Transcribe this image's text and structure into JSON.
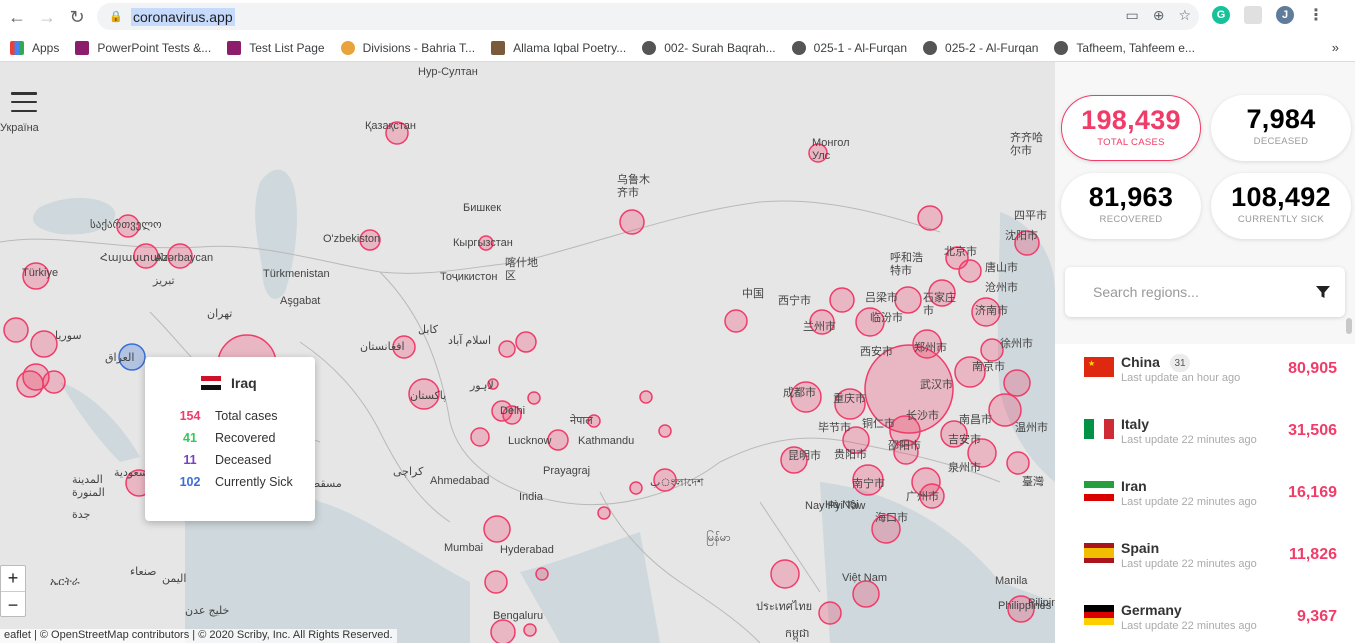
{
  "browser": {
    "url": "coronavirus.app",
    "bookmarks": [
      "Apps",
      "PowerPoint Tests &...",
      "Test List Page",
      "Divisions - Bahria T...",
      "Allama Iqbal Poetry...",
      "002- Surah Baqrah...",
      "025-1 - Al-Furqan",
      "025-2 - Al-Furqan",
      "Tafheem, Tahfeem e..."
    ],
    "bookmark_colors": [
      "#e94235",
      "#8b1d6b",
      "#8b1d6b",
      "#e8a33a",
      "#7a5a3a",
      "#555555",
      "#555555",
      "#555555",
      "#555555"
    ],
    "more": "»",
    "ext_g": "G",
    "profile": "J"
  },
  "map": {
    "labels": [
      "Нур-Султан",
      "Україна",
      "Қазақстан",
      "Монгол\nУлс",
      "乌鲁木\n齐市",
      "Бишкек",
      "საქართველო",
      "Հայաստան",
      "Azərbaycan",
      "O'zbekiston",
      "Кыргызстан",
      "Türkiye",
      "Türkmenistan",
      "Aşgabat",
      "Тоҷикистон",
      "喀什地\n区",
      "تبریز",
      "سوريا",
      "العراق",
      "تهران",
      "کابل",
      "اسلام آباد",
      "افغانستان",
      "پاکستان",
      "لاہور",
      "Delhi",
      "नेपाल",
      "Lucknow",
      "Kathmandu",
      "Prayagraj",
      "Ahmedabad",
      "India",
      "كراچى",
      "Mumbai",
      "Hyderabad",
      "Bengaluru",
      "بংলাদেশ",
      "မြန်မာ",
      "Nay Pyi Taw",
      "Việt Nam",
      "Hà Nội",
      "ประเทศไทย",
      "中国",
      "西宁市",
      "兰州市",
      "呼和浩\n特市",
      "北京市",
      "唐山市",
      "沈阳市",
      "四平市",
      "齐齐哈\n尔市",
      "吕梁市",
      "石家庄\n市",
      "沧州市",
      "济南市",
      "临汾市",
      "西安市",
      "郑州市",
      "徐州市",
      "南京市",
      "武汉市",
      "成都市",
      "重庆市",
      "铜仁市",
      "长沙市",
      "南昌市",
      "温州市",
      "毕节市",
      "贵阳市",
      "邵阳市",
      "吉安市",
      "泉州市",
      "昆明市",
      "南宁市",
      "广州市",
      "海口市",
      "臺灣",
      "Manila",
      "Philippines",
      "المدينة\nالمنورة",
      "جدة",
      "صنعاء",
      "اليمن",
      "ኤርትራ",
      "مسقط",
      "السعودية",
      "خليج عدن",
      "កម្ពុជា",
      "Pilipinas"
    ],
    "hamburger": "menu",
    "zoom_in": "+",
    "zoom_out": "−",
    "attribution": "eaflet | © OpenStreetMap contributors | © 2020 Scriby, Inc. All Rights Reserved."
  },
  "popup": {
    "country": "Iraq",
    "rows": [
      {
        "value": "154",
        "label": "Total cases",
        "color": "#f03c69"
      },
      {
        "value": "41",
        "label": "Recovered",
        "color": "#34c759"
      },
      {
        "value": "11",
        "label": "Deceased",
        "color": "#7b3fc4"
      },
      {
        "value": "102",
        "label": "Currently Sick",
        "color": "#3a6fd8"
      }
    ]
  },
  "stats": {
    "total": {
      "value": "198,439",
      "label": "TOTAL CASES",
      "color": "#f03c69"
    },
    "deceased": {
      "value": "7,984",
      "label": "DECEASED",
      "color": "#222222"
    },
    "recovered": {
      "value": "81,963",
      "label": "RECOVERED",
      "color": "#222222"
    },
    "sick": {
      "value": "108,492",
      "label": "CURRENTLY SICK",
      "color": "#222222"
    }
  },
  "search": {
    "placeholder": "Search regions..."
  },
  "countries": [
    {
      "name": "China",
      "badge": "31",
      "update": "Last update an hour ago",
      "cases": "80,905",
      "flag": "china"
    },
    {
      "name": "Italy",
      "badge": "",
      "update": "Last update 22 minutes ago",
      "cases": "31,506",
      "flag": "italy"
    },
    {
      "name": "Iran",
      "badge": "",
      "update": "Last update 22 minutes ago",
      "cases": "16,169",
      "flag": "iran"
    },
    {
      "name": "Spain",
      "badge": "",
      "update": "Last update 22 minutes ago",
      "cases": "11,826",
      "flag": "spain"
    },
    {
      "name": "Germany",
      "badge": "",
      "update": "Last update 22 minutes ago",
      "cases": "9,367",
      "flag": "germany"
    }
  ]
}
